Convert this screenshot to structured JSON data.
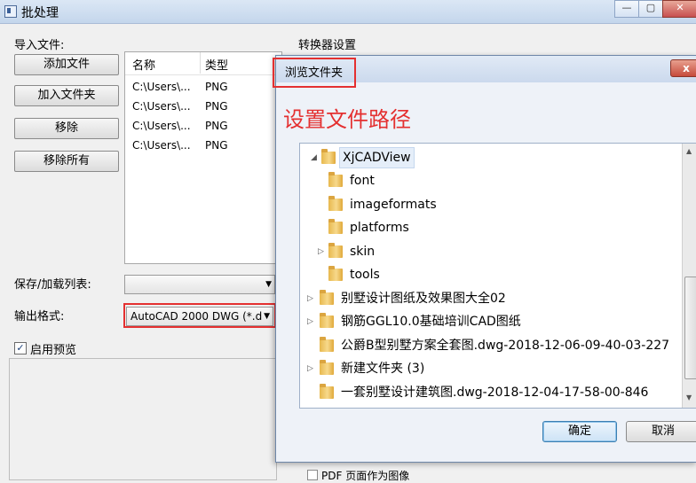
{
  "window": {
    "title": "批处理"
  },
  "left": {
    "import_label": "导入文件:",
    "buttons": {
      "add_file": "添加文件",
      "add_folder": "加入文件夹",
      "remove": "移除",
      "remove_all": "移除所有"
    },
    "list": {
      "headers": {
        "name": "名称",
        "type": "类型"
      },
      "rows": [
        {
          "name": "C:\\Users\\...",
          "type": "PNG"
        },
        {
          "name": "C:\\Users\\...",
          "type": "PNG"
        },
        {
          "name": "C:\\Users\\...",
          "type": "PNG"
        },
        {
          "name": "C:\\Users\\...",
          "type": "PNG"
        }
      ]
    },
    "save_list_label": "保存/加载列表:",
    "output_format_label": "输出格式:",
    "output_format_value": "AutoCAD 2000 DWG (*.d",
    "enable_preview_label": "启用预览"
  },
  "right": {
    "converter_settings_label": "转换器设置",
    "pdf_label": "PDF 页面作为图像"
  },
  "dialog": {
    "title": "浏览文件夹",
    "instruction": "设置文件路径",
    "close_label": "x",
    "tree": [
      {
        "label": "XjCADView",
        "expander": "◢"
      },
      {
        "label": "font",
        "expander": ""
      },
      {
        "label": "imageformats",
        "expander": ""
      },
      {
        "label": "platforms",
        "expander": ""
      },
      {
        "label": "skin",
        "expander": "▷"
      },
      {
        "label": "tools",
        "expander": ""
      },
      {
        "label": "别墅设计图纸及效果图大全02",
        "expander": "▷"
      },
      {
        "label": "钢筋GGL10.0基础培训CAD图纸",
        "expander": "▷"
      },
      {
        "label": "公爵B型别墅方案全套图.dwg-2018-12-06-09-40-03-227",
        "expander": ""
      },
      {
        "label": "新建文件夹 (3)",
        "expander": "▷"
      },
      {
        "label": "一套别墅设计建筑图.dwg-2018-12-04-17-58-00-846",
        "expander": ""
      }
    ],
    "ok_label": "确定",
    "cancel_label": "取消"
  },
  "colors": {
    "highlight": "#e43030"
  }
}
